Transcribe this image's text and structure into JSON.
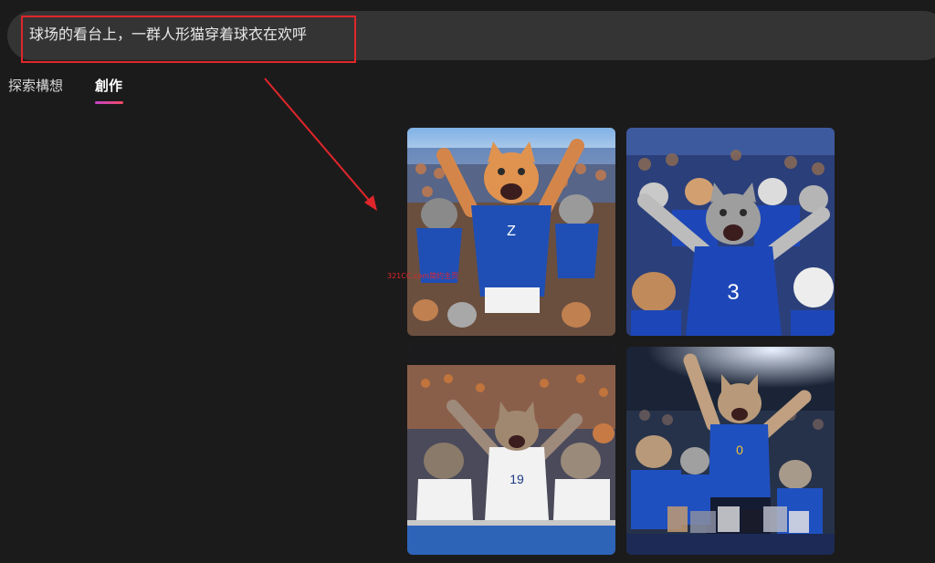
{
  "prompt": {
    "text": "球场的看台上，一群人形猫穿着球衣在欢呼"
  },
  "tabs": [
    {
      "label": "探索構想",
      "active": false
    },
    {
      "label": "創作",
      "active": true
    }
  ],
  "overlay_text": "321CC.com简约主页",
  "images": [
    {
      "name": "generated-image-1",
      "jersey_number": "Z",
      "jersey_color": "#1f4fb5"
    },
    {
      "name": "generated-image-2",
      "jersey_number": "3",
      "jersey_color": "#1d47b8"
    },
    {
      "name": "generated-image-3",
      "jersey_number": "19",
      "jersey_color": "#f2f2f2"
    },
    {
      "name": "generated-image-4",
      "jersey_number": "0",
      "jersey_color": "#1f50c0"
    }
  ],
  "colors": {
    "background": "#1c1b1b",
    "prompt_bar": "#353434",
    "annotation": "#e0262b",
    "tab_underline_start": "#c742c9",
    "tab_underline_end": "#f04a62"
  }
}
